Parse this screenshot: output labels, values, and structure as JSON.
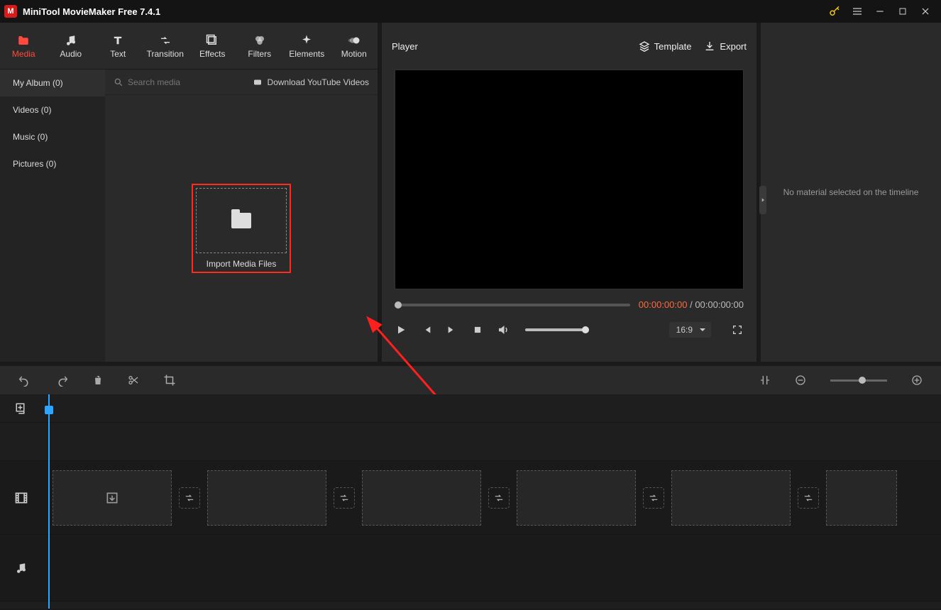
{
  "app": {
    "title": "MiniTool MovieMaker Free 7.4.1"
  },
  "tabs": {
    "media": "Media",
    "audio": "Audio",
    "text": "Text",
    "transition": "Transition",
    "effects": "Effects",
    "filters": "Filters",
    "elements": "Elements",
    "motion": "Motion"
  },
  "sidebar": {
    "my_album": "My Album (0)",
    "videos": "Videos (0)",
    "music": "Music (0)",
    "pictures": "Pictures (0)"
  },
  "search": {
    "placeholder": "Search media"
  },
  "yt": {
    "label": "Download YouTube Videos"
  },
  "import": {
    "label": "Import Media Files"
  },
  "player": {
    "title": "Player",
    "template": "Template",
    "export": "Export",
    "time_current": "00:00:00:00",
    "time_sep": " / ",
    "time_total": "00:00:00:00",
    "ratio": "16:9"
  },
  "right": {
    "empty": "No material selected on the timeline"
  }
}
